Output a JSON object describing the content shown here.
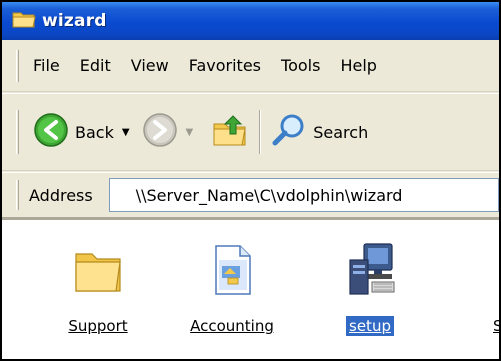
{
  "window": {
    "title": "wizard"
  },
  "menu": {
    "items": [
      "File",
      "Edit",
      "View",
      "Favorites",
      "Tools",
      "Help"
    ]
  },
  "toolbar": {
    "back_label": "Back",
    "search_label": "Search"
  },
  "address": {
    "label": "Address",
    "value": "\\\\Server_Name\\C\\vdolphin\\wizard"
  },
  "content": {
    "items": [
      {
        "label": "Support",
        "icon": "folder-icon",
        "selected": false
      },
      {
        "label": "Accounting",
        "icon": "document-icon",
        "selected": false
      },
      {
        "label": "setup",
        "icon": "setup-computer-icon",
        "selected": true
      },
      {
        "label": "S",
        "icon": "",
        "selected": false
      }
    ]
  },
  "colors": {
    "title_bar": "#0a4ad0",
    "selection": "#316ac5",
    "chrome": "#ece9d8"
  }
}
